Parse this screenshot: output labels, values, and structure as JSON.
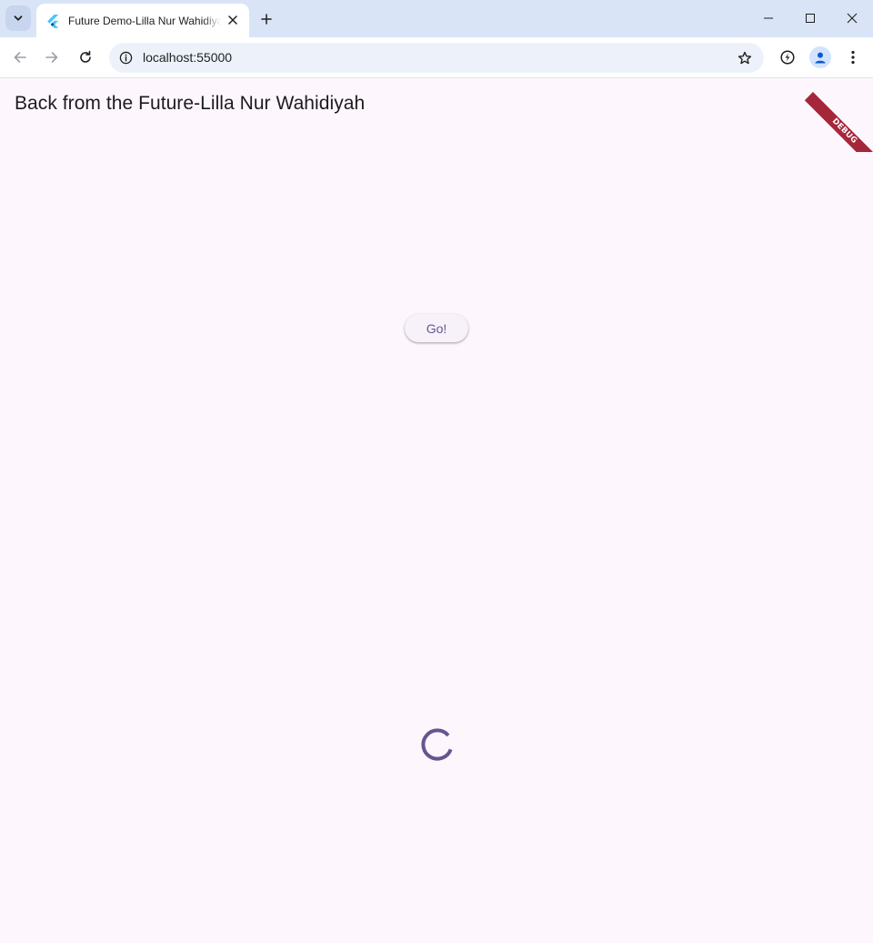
{
  "browser": {
    "tab": {
      "title": "Future Demo-Lilla Nur Wahidiyah",
      "favicon": "flutter-logo-icon"
    },
    "address_bar": {
      "url": "localhost:55000"
    },
    "icons": {
      "tab_search": "chevron-down-icon",
      "new_tab": "plus-icon",
      "minimize": "minimize-icon",
      "maximize": "maximize-icon",
      "close": "close-icon",
      "back": "arrow-left-icon",
      "forward": "arrow-right-icon",
      "reload": "reload-icon",
      "site_info": "info-icon",
      "bookmark": "star-icon",
      "performance": "performance-icon",
      "profile": "person-icon",
      "menu": "kebab-menu-icon"
    }
  },
  "app": {
    "title": "Back from the Future-Lilla Nur Wahidiyah",
    "go_button_label": "Go!",
    "debug_banner_label": "DEBUG",
    "loading_indicator": "circular-progress-icon"
  },
  "colors": {
    "background": "#fdf7fd",
    "primary": "#65558f",
    "button_surface": "#f7f2fa",
    "debug_banner": "#a5273a"
  }
}
